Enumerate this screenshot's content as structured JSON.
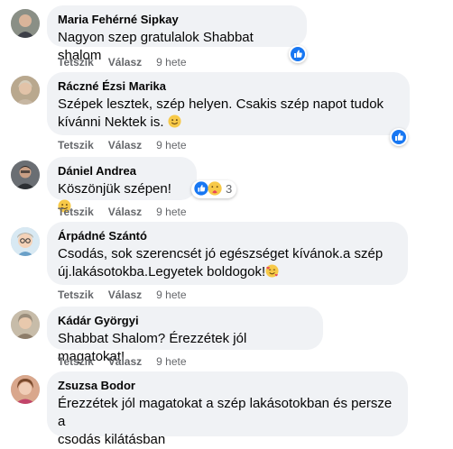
{
  "colors": {
    "bubble": "#f0f2f5",
    "like_blue": "#1877f2",
    "meta_text": "#65676b",
    "text": "#050505"
  },
  "comments": [
    {
      "author": "Maria Fehérné Sipkay",
      "lines": [
        "Nagyon szep gratulalok Shabbat shalom"
      ],
      "like_label": "Tetszik",
      "reply_label": "Válasz",
      "time": "9 hete",
      "reaction": "like-icon"
    },
    {
      "author": "Ráczné Ézsi Marika",
      "lines": [
        "Szépek lesztek, szép helyen. Csakis szép napot tudok",
        "kívánni Nektek is."
      ],
      "like_label": "Tetszik",
      "reply_label": "Válasz",
      "time": "9 hete",
      "emoji": "smile-emoji",
      "reaction": "like-icon"
    },
    {
      "author": "Dániel Andrea",
      "lines": [
        "Köszönjük szépen!"
      ],
      "like_label": "Tetszik",
      "reply_label": "Válasz",
      "time": "9 hete",
      "emoji": "smile-emoji",
      "reactions": [
        "like-icon",
        "care-icon"
      ],
      "reaction_count": "3"
    },
    {
      "author": "Árpádné Szántó",
      "lines": [
        "Csodás, sok szerencsét jó egészséget kívánok.a szép",
        "új.lakásotokba.Legyetek boldogok!"
      ],
      "like_label": "Tetszik",
      "reply_label": "Válasz",
      "time": "9 hete",
      "emoji": "smiling-face-with-hearts-emoji"
    },
    {
      "author": "Kádár Györgyi",
      "lines": [
        "Shabbat Shalom? Érezzétek jól magatokat!"
      ],
      "like_label": "Tetszik",
      "reply_label": "Válasz",
      "time": "9 hete"
    },
    {
      "author": "Zsuzsa Bodor",
      "lines": [
        "Érezzétek jól magatokat a szép lakásotokban és persze a",
        "csodás kilátásban"
      ]
    }
  ]
}
